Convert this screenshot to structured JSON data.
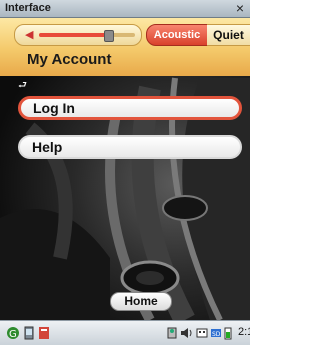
{
  "window": {
    "title": "Interface",
    "close_glyph": "×"
  },
  "header": {
    "volume": {
      "level": 0.72
    },
    "modes": [
      {
        "label": "Acoustic",
        "selected": true
      },
      {
        "label": "Quiet",
        "selected": false
      }
    ],
    "page_title": "My Account",
    "back_glyph": "⮐"
  },
  "menu": {
    "items": [
      {
        "label": "Log In",
        "selected": true
      },
      {
        "label": "Help",
        "selected": false
      }
    ]
  },
  "footer": {
    "home_label": "Home"
  },
  "taskbar": {
    "start_icon": "start-icon",
    "icons": [
      "device-icon",
      "app-icon",
      "network-icon",
      "volume-icon",
      "keyboard-icon",
      "usb-icon",
      "battery-icon"
    ],
    "clock": "2:1"
  },
  "colors": {
    "accent": "#e2543c",
    "header_gold": "#f4c96a"
  }
}
